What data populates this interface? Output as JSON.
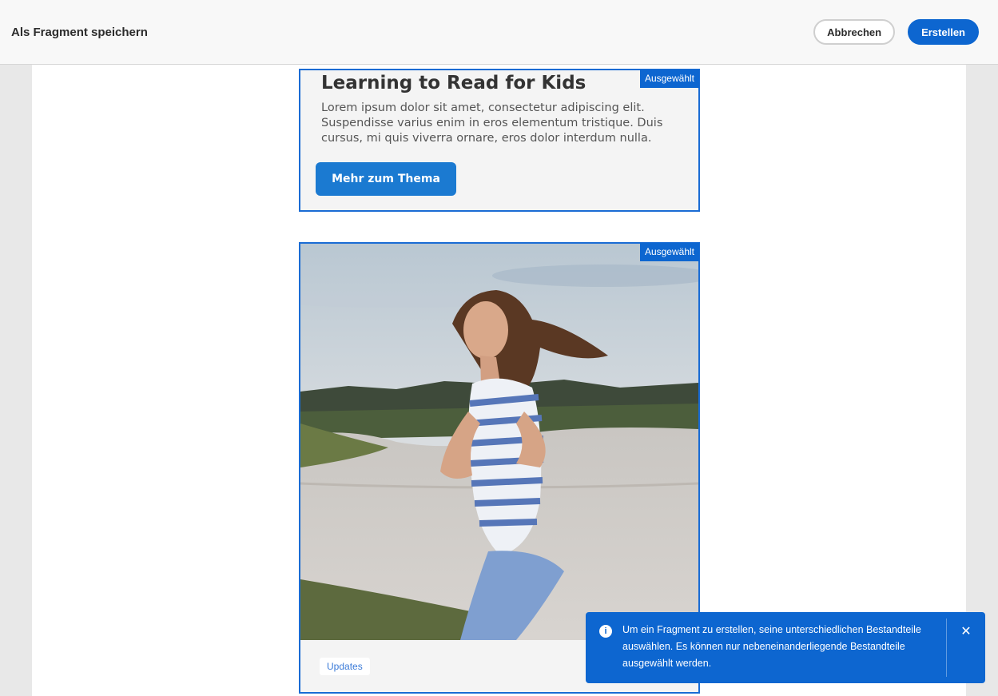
{
  "header": {
    "title": "Als Fragment speichern",
    "cancel_label": "Abbrechen",
    "create_label": "Erstellen"
  },
  "fragments": [
    {
      "badge": "Ausgewählt",
      "heading": "Learning to Read for Kids",
      "body": "Lorem ipsum dolor sit amet, consectetur adipiscing elit. Suspendisse varius enim in eros elementum tristique. Duis cursus, mi quis viverra ornare, eros dolor interdum nulla.",
      "button_label": "Mehr zum Thema"
    },
    {
      "badge": "Ausgewählt",
      "image": "woman-jogging-by-lake",
      "tag": "Updates"
    }
  ],
  "toast": {
    "icon": "info-icon",
    "message": "Um ein Fragment zu erstellen, seine unterschiedlichen Bestandteile auswählen. Es können nur nebeneinanderliegende Bestandteile ausgewählt werden.",
    "close_icon": "close-icon"
  },
  "colors": {
    "accent": "#0d66d0",
    "selection_border": "#1a6cd4",
    "cta_button": "#1b7ad1"
  }
}
